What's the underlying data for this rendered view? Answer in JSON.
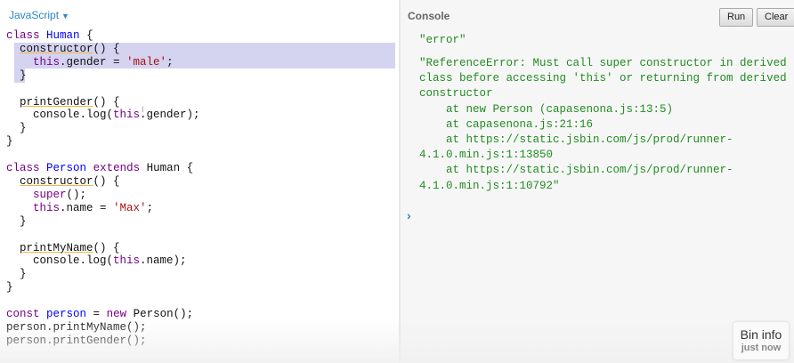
{
  "editor": {
    "language": "JavaScript",
    "code": {
      "l1": [
        "class",
        "Human",
        "{"
      ],
      "l2": [
        "constructor",
        "() {"
      ],
      "l3": [
        "this",
        ".gender = ",
        "'male'",
        ";"
      ],
      "l4": "}",
      "l6": [
        "printGender",
        "() {"
      ],
      "l7": [
        "console.log(",
        "this",
        ".gender);"
      ],
      "l8": "}",
      "l9": "}",
      "l11": [
        "class",
        "Person",
        "extends",
        "Human",
        "{"
      ],
      "l12": [
        "constructor",
        "() {"
      ],
      "l13": [
        "super",
        "();"
      ],
      "l14": [
        "this",
        ".name = ",
        "'Max'",
        ";"
      ],
      "l15": "}",
      "l17": [
        "printMyName",
        "() {"
      ],
      "l18": [
        "console.log(",
        "this",
        ".name);"
      ],
      "l19": "}",
      "l20": "}",
      "l22": [
        "const",
        "person",
        " = ",
        "new",
        " Person();"
      ],
      "l23": "person.printMyName();",
      "l24": "person.printGender();"
    }
  },
  "console": {
    "title": "Console",
    "run_label": "Run",
    "clear_label": "Clear",
    "output1": "\"error\"",
    "output2": "\"ReferenceError: Must call super constructor in derived\nclass before accessing 'this' or returning from derived\nconstructor\n    at new Person (capasenona.js:13:5)\n    at capasenona.js:21:16\n    at https://static.jsbin.com/js/prod/runner-\n4.1.0.min.js:1:13850\n    at https://static.jsbin.com/js/prod/runner-\n4.1.0.min.js:1:10792\"",
    "prompt": "›"
  },
  "bin_info": {
    "title": "Bin info",
    "subtitle": "just now"
  },
  "colors": {
    "keyword": "#770088",
    "definition": "#0000ff",
    "string": "#aa1111",
    "console_text": "#228b22",
    "accent": "#2b86c6",
    "selection": "#d4d3f0"
  }
}
